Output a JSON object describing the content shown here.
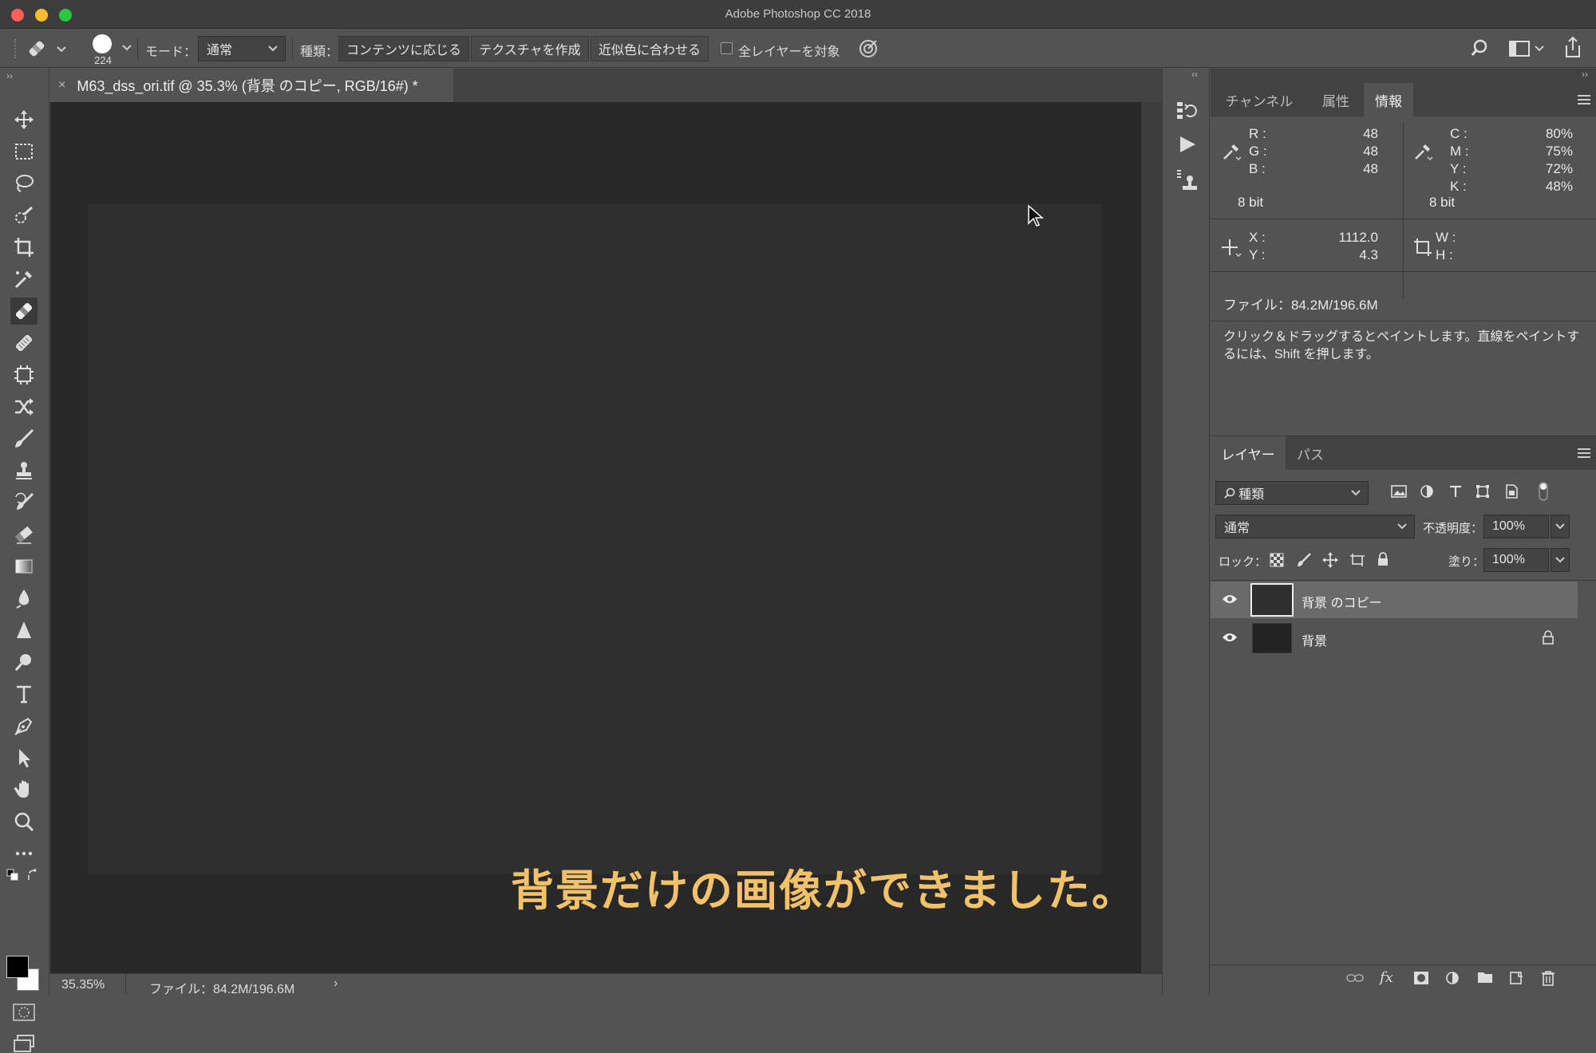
{
  "window": {
    "title": "Adobe Photoshop CC 2018"
  },
  "options_bar": {
    "brush_size": "224",
    "mode_label": "モード：",
    "mode_value": "通常",
    "type_label": "種類：",
    "type_buttons": [
      "コンテンツに応じる",
      "テクスチャを作成",
      "近似色に合わせる"
    ],
    "sample_all_label": "全レイヤーを対象"
  },
  "document": {
    "tab_title": "M63_dss_ori.tif @ 35.3% (背景 のコピー, RGB/16#) *",
    "overlay_caption": "背景だけの画像ができました。",
    "zoom": "35.35%",
    "file_info": "ファイル：84.2M/196.6M"
  },
  "info_panel": {
    "tabs": [
      "チャンネル",
      "属性",
      "情報"
    ],
    "active_tab": "情報",
    "rgb": {
      "r_label": "R :",
      "g_label": "G :",
      "b_label": "B :",
      "r": "48",
      "g": "48",
      "b": "48",
      "bit": "8 bit"
    },
    "cmyk": {
      "c_label": "C :",
      "m_label": "M :",
      "y_label": "Y :",
      "k_label": "K :",
      "c": "80%",
      "m": "75%",
      "y": "72%",
      "k": "48%",
      "bit": "8 bit"
    },
    "xy": {
      "x_label": "X :",
      "y_label": "Y :",
      "x": "1112.0",
      "y": "4.3"
    },
    "wh": {
      "w_label": "W :",
      "h_label": "H :"
    },
    "file": "ファイル：84.2M/196.6M",
    "hint": "クリック＆ドラッグするとペイントします。直線をペイントするには、Shift を押します。"
  },
  "layers_panel": {
    "tabs": [
      "レイヤー",
      "パス"
    ],
    "active_tab": "レイヤー",
    "filter_kind": "種類",
    "blend_mode": "通常",
    "opacity_label": "不透明度：",
    "opacity": "100%",
    "lock_label": "ロック：",
    "fill_label": "塗り：",
    "fill": "100%",
    "layers": [
      {
        "name": "背景 のコピー",
        "selected": true,
        "locked": false
      },
      {
        "name": "背景",
        "selected": false,
        "locked": true
      }
    ]
  },
  "colors": {
    "accent_caption": "#f2c26b",
    "foreground": "#000000",
    "background": "#ffffff"
  }
}
